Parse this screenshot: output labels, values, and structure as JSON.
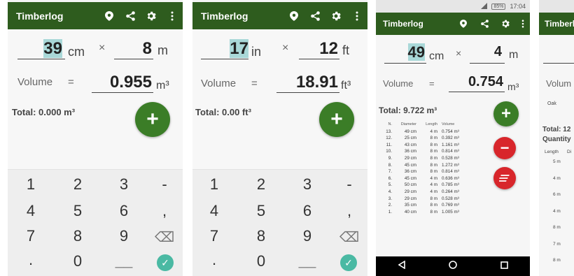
{
  "colors": {
    "appbar": "#2e5c1e",
    "fab_green": "#3b7d27",
    "fab_red": "#d8262b",
    "highlight": "#a9d8d8",
    "check": "#4ab9a3"
  },
  "screen1": {
    "title": "Timberlog",
    "dim1": {
      "value": "39",
      "unit": "cm"
    },
    "times": "×",
    "dim2": {
      "value": "8",
      "unit": "m"
    },
    "volume_label": "Volume",
    "equals": "=",
    "volume_value": "0.955",
    "volume_unit": "m³",
    "total": "Total: 0.000 m³",
    "add": "+",
    "keys": [
      "1",
      "2",
      "3",
      "-",
      "4",
      "5",
      "6",
      ",",
      "7",
      "8",
      "9",
      "⌫",
      ".",
      "0",
      "__",
      "✓"
    ]
  },
  "screen2": {
    "title": "Timberlog",
    "dim1": {
      "value": "17",
      "unit": "in"
    },
    "times": "×",
    "dim2": {
      "value": "12",
      "unit": "ft"
    },
    "volume_label": "Volume",
    "equals": "=",
    "volume_value": "18.91",
    "volume_unit": "ft³",
    "total": "Total: 0.00 ft³",
    "add": "+",
    "keys": [
      "1",
      "2",
      "3",
      "-",
      "4",
      "5",
      "6",
      ",",
      "7",
      "8",
      "9",
      "⌫",
      ".",
      "0",
      "__",
      "✓"
    ]
  },
  "screen3": {
    "status": {
      "battery": "85%",
      "time": "17:04"
    },
    "title": "Timberlog",
    "dim1": {
      "value": "49",
      "unit": "cm"
    },
    "times": "×",
    "dim2": {
      "value": "4",
      "unit": "m"
    },
    "volume_label": "Volume",
    "equals": "=",
    "volume_value": "0.754",
    "volume_unit": "m³",
    "total": "Total: 9.722 m³",
    "add": "+",
    "remove": "−",
    "log_headers": [
      "N.",
      "Diameter",
      "Length",
      "Volume"
    ],
    "log": [
      [
        "13.",
        "49 cm",
        "4 m",
        "0.754 m³"
      ],
      [
        "12.",
        "25 cm",
        "8 m",
        "0.392 m³"
      ],
      [
        "11.",
        "43 cm",
        "8 m",
        "1.161 m³"
      ],
      [
        "10.",
        "36 cm",
        "8 m",
        "0.814 m³"
      ],
      [
        "9.",
        "29 cm",
        "8 m",
        "0.528 m³"
      ],
      [
        "8.",
        "45 cm",
        "8 m",
        "1.272 m³"
      ],
      [
        "7.",
        "36 cm",
        "8 m",
        "0.814 m³"
      ],
      [
        "6.",
        "45 cm",
        "4 m",
        "0.636 m³"
      ],
      [
        "5.",
        "50 cm",
        "4 m",
        "0.785 m³"
      ],
      [
        "4.",
        "29 cm",
        "4 m",
        "0.264 m³"
      ],
      [
        "3.",
        "29 cm",
        "8 m",
        "0.528 m³"
      ],
      [
        "2.",
        "35 cm",
        "8 m",
        "0.769 m³"
      ],
      [
        "1.",
        "40 cm",
        "8 m",
        "1.005 m³"
      ]
    ]
  },
  "screen4": {
    "title": "Timberl",
    "volume_label": "Volum",
    "species": "Oak",
    "total": "Total: 12",
    "quantity": "Quantity",
    "length_header": "Length",
    "dia_header": "Di",
    "lengths": [
      "5 m",
      "4 m",
      "6 m",
      "4 m",
      "8 m",
      "7 m",
      "8 m"
    ]
  }
}
